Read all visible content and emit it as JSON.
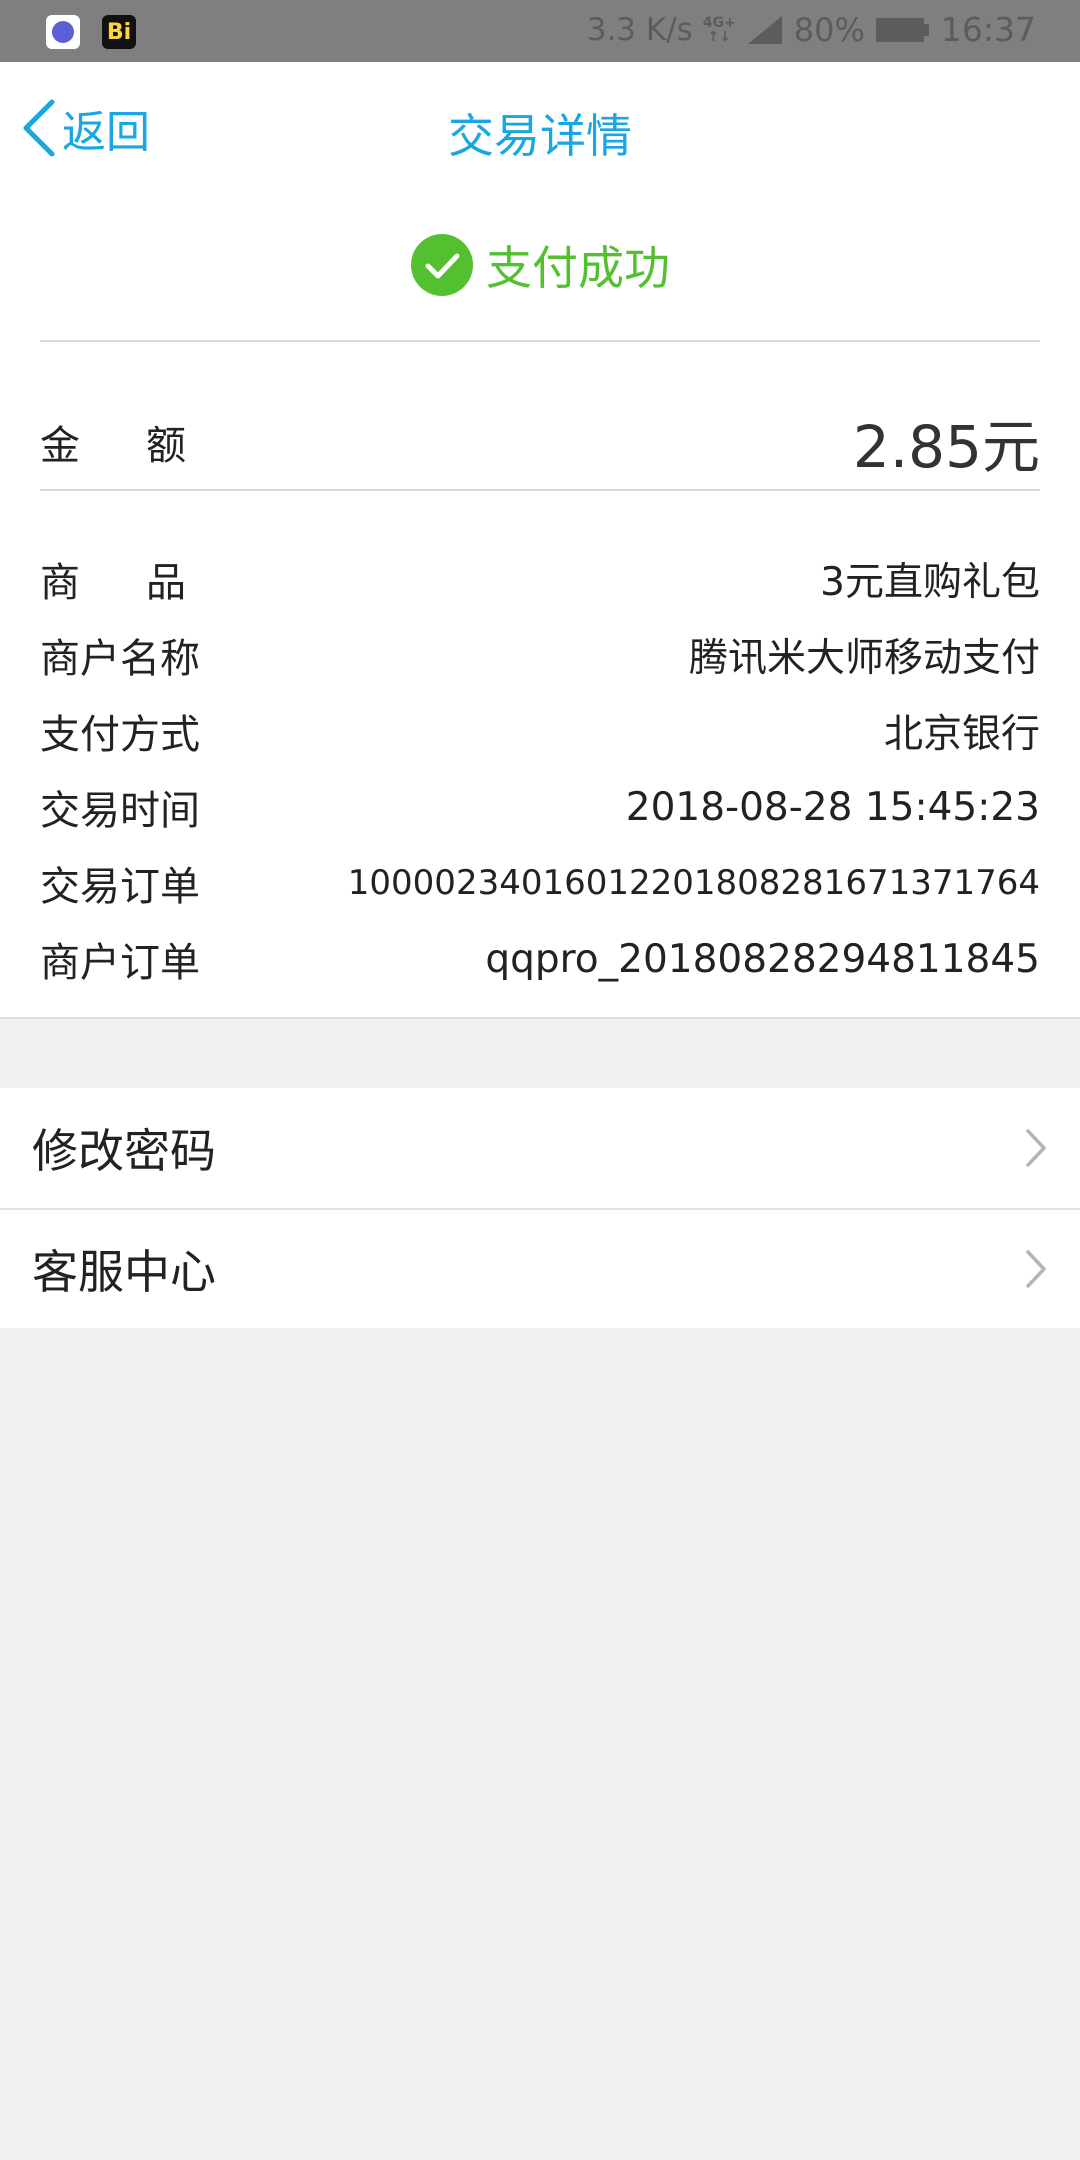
{
  "status_bar": {
    "net_speed": "3.3 K/s",
    "network_type_top": "4G+",
    "network_type_bottom": "↑↓",
    "battery": "80%",
    "time": "16:37",
    "apps": [
      "notification-app-icon",
      "bi-app-icon"
    ],
    "bi_label": "Bi"
  },
  "header": {
    "back_label": "返回",
    "title": "交易详情"
  },
  "result": {
    "status_text": "支付成功",
    "status_color": "#53c12f"
  },
  "amount": {
    "label": "金额",
    "value": "2.85元"
  },
  "details": [
    {
      "label": "商品",
      "value": "3元直购礼包"
    },
    {
      "label": "商户名称",
      "value": "腾讯米大师移动支付"
    },
    {
      "label": "支付方式",
      "value": "北京银行"
    },
    {
      "label": "交易时间",
      "value": "2018-08-28 15:45:23"
    },
    {
      "label": "交易订单",
      "value": "10000234016012201808281671371764"
    },
    {
      "label": "商户订单",
      "value": "qqpro_20180828294811845"
    }
  ],
  "menu": [
    {
      "label": "修改密码",
      "icon": "chevron-right-icon"
    },
    {
      "label": "客服中心",
      "icon": "chevron-right-icon"
    }
  ],
  "colors": {
    "accent": "#1aa6e2",
    "success": "#53c12f",
    "background": "#f0f0f0"
  }
}
